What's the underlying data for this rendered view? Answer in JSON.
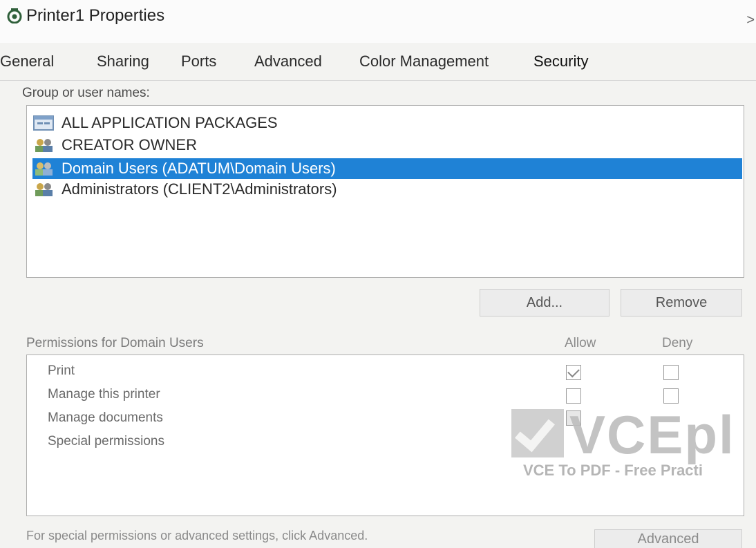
{
  "window": {
    "title": "Printer1 Properties",
    "close_glyph": ">"
  },
  "tabs": [
    {
      "label": "General"
    },
    {
      "label": "Sharing"
    },
    {
      "label": "Ports"
    },
    {
      "label": "Advanced"
    },
    {
      "label": "Color Management"
    },
    {
      "label": "Security"
    }
  ],
  "security": {
    "group_label": "Group or user names:",
    "users": [
      {
        "name": "ALL APPLICATION PACKAGES",
        "icon": "app-packages-icon"
      },
      {
        "name": "CREATOR OWNER",
        "icon": "users-icon"
      },
      {
        "name": "Domain Users (ADATUM\\Domain Users)",
        "icon": "users-icon",
        "selected": true
      },
      {
        "name": "Administrators (CLIENT2\\Administrators)",
        "icon": "users-icon"
      }
    ],
    "add_label": "Add...",
    "remove_label": "Remove",
    "permissions_label": "Permissions for Domain Users",
    "allow_label": "Allow",
    "deny_label": "Deny",
    "permissions": [
      {
        "name": "Print",
        "allow": true,
        "deny": false
      },
      {
        "name": "Manage this printer",
        "allow": false,
        "deny": false
      },
      {
        "name": "Manage documents",
        "allow": "partial",
        "deny": false
      },
      {
        "name": "Special permissions",
        "allow": null,
        "deny": null
      }
    ],
    "footer_text": "For special permissions or advanced settings, click Advanced.",
    "advanced_label": "Advanced"
  },
  "watermark": {
    "brand": "VCEpl",
    "tagline": "VCE To PDF - Free Practi"
  }
}
